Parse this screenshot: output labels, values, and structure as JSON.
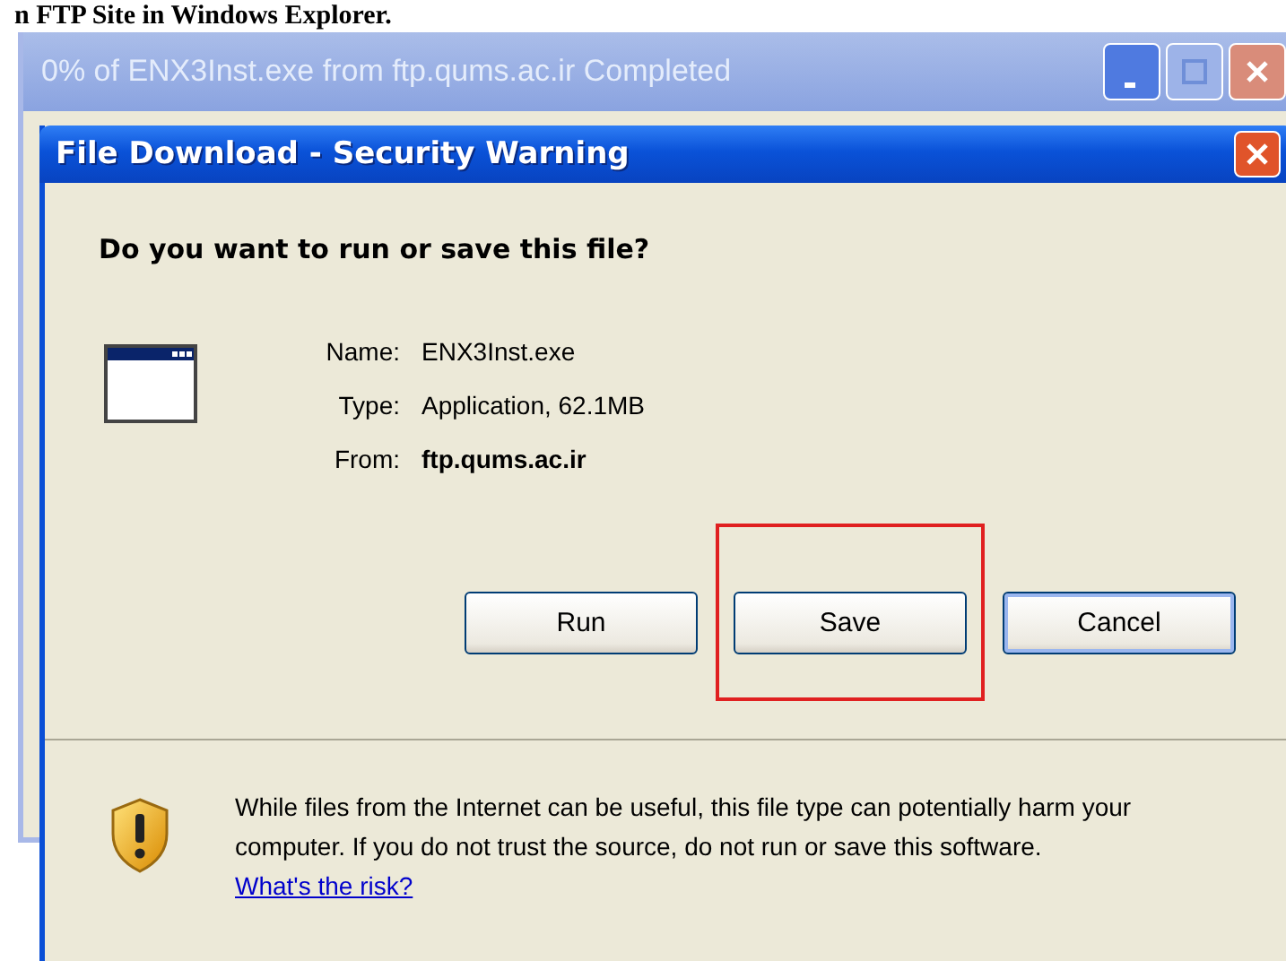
{
  "page_heading": "n FTP Site in Windows Explorer.",
  "back_window": {
    "title": "0% of ENX3Inst.exe from ftp.qums.ac.ir Completed"
  },
  "dialog": {
    "title": "File Download - Security Warning",
    "question": "Do you want to run or save this file?",
    "fields": [
      {
        "label": "Name:",
        "value": "ENX3Inst.exe",
        "bold": false
      },
      {
        "label": "Type:",
        "value": "Application, 62.1MB",
        "bold": false
      },
      {
        "label": "From:",
        "value": "ftp.qums.ac.ir",
        "bold": true
      }
    ],
    "buttons": [
      {
        "label": "Run",
        "default": false,
        "highlighted": false
      },
      {
        "label": "Save",
        "default": false,
        "highlighted": true
      },
      {
        "label": "Cancel",
        "default": true,
        "highlighted": false
      }
    ],
    "warning": {
      "text": "While files from the Internet can be useful, this file type can potentially harm your computer. If you do not trust the source, do not run or save this software.",
      "link": "What's the risk?"
    }
  }
}
